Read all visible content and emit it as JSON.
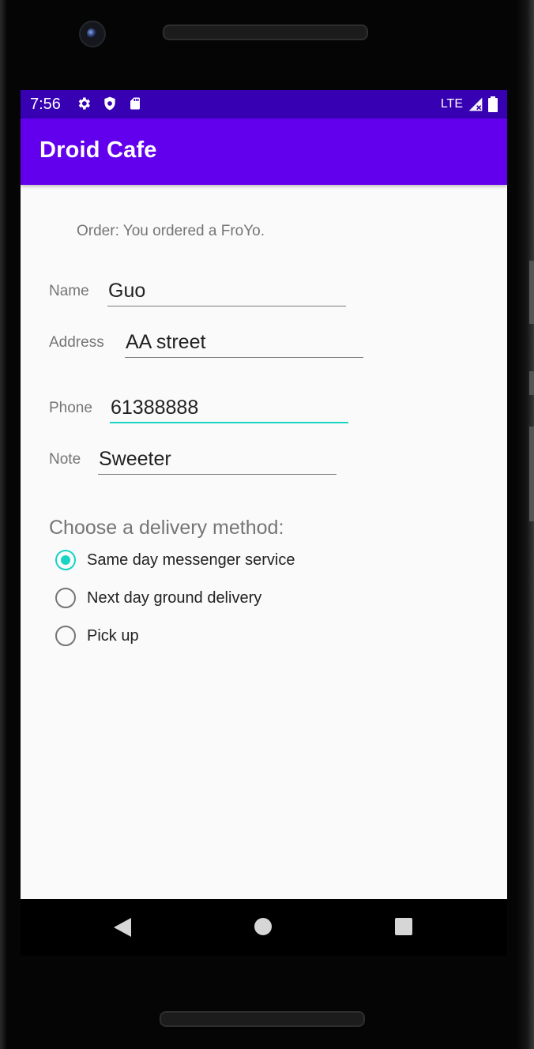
{
  "status_bar": {
    "time": "7:56",
    "network": "LTE",
    "icons": [
      "gear-icon",
      "shield-icon",
      "sd-card-icon",
      "signal-icon",
      "battery-icon"
    ]
  },
  "app_bar": {
    "title": "Droid Cafe"
  },
  "order": {
    "message": "Order: You ordered a FroYo."
  },
  "form": {
    "name_label": "Name",
    "name_value": "Guo",
    "address_label": "Address",
    "address_value": "AA street",
    "phone_label": "Phone",
    "phone_value": "61388888",
    "note_label": "Note",
    "note_value": "Sweeter"
  },
  "delivery": {
    "heading": "Choose a delivery method:",
    "options": [
      {
        "label": "Same day messenger service",
        "checked": true
      },
      {
        "label": "Next day ground delivery",
        "checked": false
      },
      {
        "label": "Pick up",
        "checked": false
      }
    ]
  },
  "colors": {
    "status_bar": "#3700b3",
    "app_bar": "#6200ee",
    "accent": "#17d4c4",
    "background": "#fafafa"
  },
  "nav_bar": {
    "icons": [
      "back-icon",
      "home-icon",
      "recents-icon"
    ]
  }
}
